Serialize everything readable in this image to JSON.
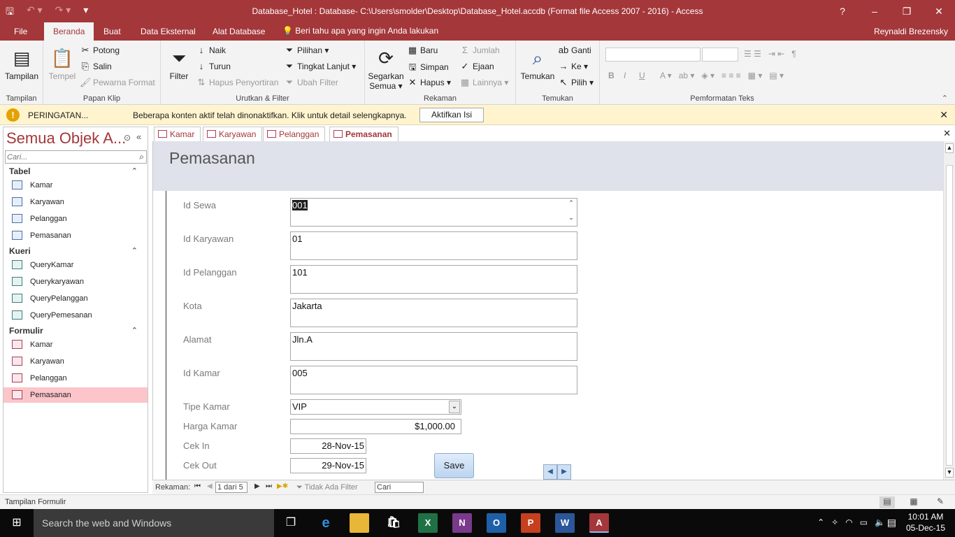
{
  "window": {
    "title": "Database_Hotel : Database- C:\\Users\\smolder\\Desktop\\Database_Hotel.accdb (Format file Access 2007 - 2016) - Access",
    "help": "?",
    "minimize": "–",
    "restore": "❐",
    "close": "✕"
  },
  "ribbon_tabs": {
    "file": "File",
    "beranda": "Beranda",
    "buat": "Buat",
    "data_eksternal": "Data Eksternal",
    "alat_database": "Alat Database",
    "tell_me": "Beri tahu apa yang ingin Anda lakukan",
    "user": "Reynaldi Brezensky"
  },
  "ribbon": {
    "tampilan": {
      "button": "Tampilan",
      "group": "Tampilan"
    },
    "papan_klip": {
      "tempel": "Tempel",
      "potong": "Potong",
      "salin": "Salin",
      "pewarna": "Pewarna Format",
      "group": "Papan Klip"
    },
    "urutkan": {
      "filter": "Filter",
      "naik": "Naik",
      "turun": "Turun",
      "hapus_penyortiran": "Hapus Penyortiran",
      "pilihan": "Pilihan",
      "tingkat_lanjut": "Tingkat Lanjut",
      "ubah_filter": "Ubah Filter",
      "group": "Urutkan & Filter"
    },
    "rekaman": {
      "segarkan": "Segarkan",
      "semua": "Semua",
      "baru": "Baru",
      "simpan": "Simpan",
      "hapus": "Hapus",
      "jumlah": "Jumlah",
      "ejaan": "Ejaan",
      "lainnya": "Lainnya",
      "group": "Rekaman"
    },
    "temukan": {
      "temukan": "Temukan",
      "ganti": "Ganti",
      "ke": "Ke",
      "pilih": "Pilih",
      "group": "Temukan"
    },
    "pemformatan": {
      "group": "Pemformatan Teks",
      "bold": "B",
      "italic": "I",
      "underline": "U"
    }
  },
  "warning": {
    "title": "PERINGATAN...",
    "message": "Beberapa konten aktif telah dinonaktifkan. Klik untuk detail selengkapnya.",
    "button": "Aktifkan Isi"
  },
  "nav_pane": {
    "title": "Semua Objek A...",
    "search_placeholder": "Cari...",
    "sections": {
      "tabel": {
        "label": "Tabel",
        "items": [
          "Kamar",
          "Karyawan",
          "Pelanggan",
          "Pemasanan"
        ]
      },
      "kueri": {
        "label": "Kueri",
        "items": [
          "QueryKamar",
          "Querykaryawan",
          "QueryPelanggan",
          "QueryPemesanan"
        ]
      },
      "formulir": {
        "label": "Formulir",
        "items": [
          "Kamar",
          "Karyawan",
          "Pelanggan",
          "Pemasanan"
        ]
      }
    }
  },
  "doc_tabs": [
    "Kamar",
    "Karyawan",
    "Pelanggan",
    "Pemasanan"
  ],
  "form": {
    "title": "Pemasanan",
    "fields": {
      "id_sewa": {
        "label": "Id Sewa",
        "value": "001"
      },
      "id_karyawan": {
        "label": "Id Karyawan",
        "value": "01"
      },
      "id_pelanggan": {
        "label": "Id Pelanggan",
        "value": "101"
      },
      "kota": {
        "label": "Kota",
        "value": "Jakarta"
      },
      "alamat": {
        "label": "Alamat",
        "value": "Jln.A"
      },
      "id_kamar": {
        "label": "Id Kamar",
        "value": "005"
      },
      "tipe_kamar": {
        "label": "Tipe Kamar",
        "value": "VIP"
      },
      "harga_kamar": {
        "label": "Harga Kamar",
        "value": "$1,000.00"
      },
      "cek_in": {
        "label": "Cek In",
        "value": "28-Nov-15"
      },
      "cek_out": {
        "label": "Cek Out",
        "value": "29-Nov-15"
      }
    },
    "save_button": "Save"
  },
  "record_bar": {
    "label": "Rekaman:",
    "position": "1 dari 5",
    "filter": "Tidak Ada Filter",
    "search": "Cari"
  },
  "status": {
    "text": "Tampilan Formulir"
  },
  "taskbar": {
    "search": "Search the web and Windows",
    "time": "10:01 AM",
    "date": "05-Dec-15"
  }
}
